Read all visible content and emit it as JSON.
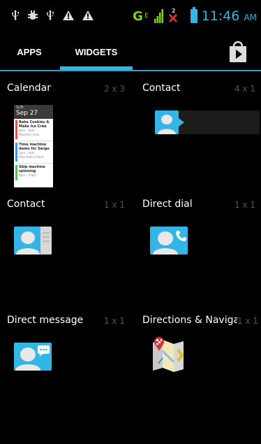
{
  "status_bar": {
    "network_label": "G",
    "network_sub": "E",
    "clock": "11:46",
    "ampm": "AM",
    "icons": [
      "usb-icon",
      "debug-icon",
      "usb-icon",
      "warning-icon",
      "warning-icon"
    ]
  },
  "tabs": [
    {
      "label": "APPS",
      "selected": false
    },
    {
      "label": "WIDGETS",
      "selected": true
    }
  ],
  "store_icon": "play-store-icon",
  "accent_color": "#33b5e5",
  "widgets": [
    {
      "name": "Calendar",
      "size": "2 x 3"
    },
    {
      "name": "Contact",
      "size": "4 x 1"
    },
    {
      "name": "Contact",
      "size": "1 x 1"
    },
    {
      "name": "Direct dial",
      "size": "1 x 1"
    },
    {
      "name": "Direct message",
      "size": "1 x 1"
    },
    {
      "name": "Directions & Naviga",
      "size": "1 x 1"
    }
  ],
  "calendar_preview": {
    "day": "SUN",
    "date": "Sep 27",
    "events": [
      {
        "title": "Bake Cookies &",
        "title2": "Make Ice Crea",
        "time": "8pm – 9pm",
        "place": "Mountain View",
        "color": "#d9534f"
      },
      {
        "title": "Time machine",
        "title2": "demo for Serge",
        "time": "3pm – 4pm",
        "place": "Blue Palace Public",
        "color": "#4a90e2"
      },
      {
        "title": "Skip machine",
        "title2": "spinning",
        "time": "9pm – 10pm",
        "place": "",
        "color": "#5cb85c"
      }
    ]
  }
}
